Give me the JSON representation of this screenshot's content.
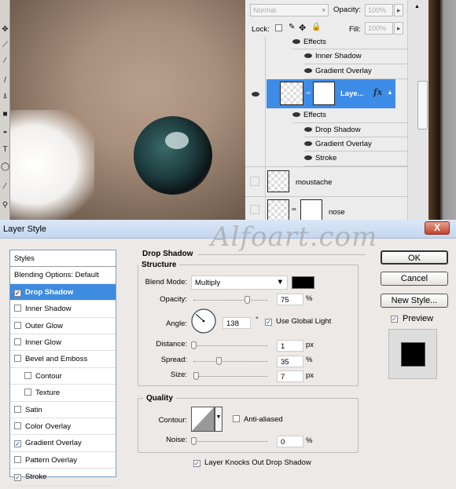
{
  "layers_panel": {
    "blend_mode": "Normal",
    "opacity_label": "Opacity:",
    "opacity": "100%",
    "lock_label": "Lock:",
    "fill_label": "Fill:",
    "fill": "100%",
    "rows": [
      {
        "type": "effects",
        "label": "Effects"
      },
      {
        "type": "effect",
        "label": "Inner Shadow"
      },
      {
        "type": "effect",
        "label": "Gradient Overlay"
      },
      {
        "type": "layer",
        "label": "Laye...",
        "fx": "fx",
        "selected": true
      },
      {
        "type": "effects",
        "label": "Effects"
      },
      {
        "type": "effect",
        "label": "Drop Shadow"
      },
      {
        "type": "effect",
        "label": "Gradient Overlay"
      },
      {
        "type": "effect",
        "label": "Stroke"
      },
      {
        "type": "layer",
        "label": "moustache"
      },
      {
        "type": "layer",
        "label": "nose"
      }
    ]
  },
  "dialog": {
    "title": "Layer Style",
    "watermark": "Alfoart.com",
    "close": "X",
    "styles_header": "Styles",
    "styles": [
      {
        "label": "Blending Options: Default"
      },
      {
        "label": "Drop Shadow",
        "checked": true,
        "selected": true
      },
      {
        "label": "Inner Shadow",
        "checked": false
      },
      {
        "label": "Outer Glow",
        "checked": false
      },
      {
        "label": "Inner Glow",
        "checked": false
      },
      {
        "label": "Bevel and Emboss",
        "checked": false
      },
      {
        "label": "Contour",
        "checked": false,
        "indent": true
      },
      {
        "label": "Texture",
        "checked": false,
        "indent": true
      },
      {
        "label": "Satin",
        "checked": false
      },
      {
        "label": "Color Overlay",
        "checked": false
      },
      {
        "label": "Gradient Overlay",
        "checked": true
      },
      {
        "label": "Pattern Overlay",
        "checked": false
      },
      {
        "label": "Stroke",
        "checked": true
      }
    ],
    "section": "Drop Shadow",
    "structure": {
      "legend": "Structure",
      "blend_mode_label": "Blend Mode:",
      "blend_mode": "Multiply",
      "color": "#000000",
      "opacity_label": "Opacity:",
      "opacity": "75",
      "opacity_unit": "%",
      "angle_label": "Angle:",
      "angle": "138",
      "angle_unit": "°",
      "use_global_light": "Use Global Light",
      "use_global_light_checked": true,
      "distance_label": "Distance:",
      "distance": "1",
      "distance_unit": "px",
      "spread_label": "Spread:",
      "spread": "35",
      "spread_unit": "%",
      "size_label": "Size:",
      "size": "7",
      "size_unit": "px"
    },
    "quality": {
      "legend": "Quality",
      "contour_label": "Contour:",
      "anti_aliased": "Anti-aliased",
      "anti_aliased_checked": false,
      "noise_label": "Noise:",
      "noise": "0",
      "noise_unit": "%"
    },
    "knocks_out": "Layer Knocks Out Drop Shadow",
    "knocks_out_checked": true,
    "buttons": {
      "ok": "OK",
      "cancel": "Cancel",
      "new_style": "New Style..."
    },
    "preview_label": "Preview",
    "preview_checked": true
  }
}
